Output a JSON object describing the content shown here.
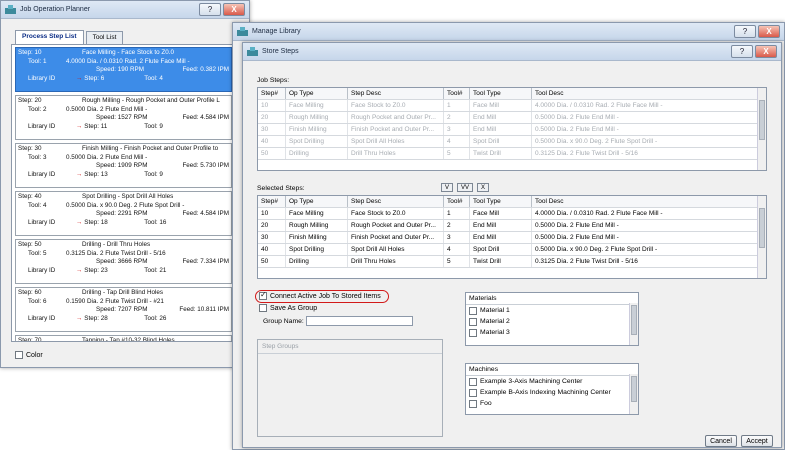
{
  "jop": {
    "title": "Job Operation Planner",
    "tabs": [
      "Process Step List",
      "Tool List"
    ],
    "steps": [
      {
        "step": "Step: 10",
        "title": "Face Milling - Face Stock to Z0.0",
        "tool": "Tool: 1",
        "desc": "4.0000 Dia. / 0.0310 Rad. 2 Flute Face Mill -",
        "speed": "Speed: 190 RPM",
        "feed": "Feed: 0.382 IPM",
        "lib": "Library ID",
        "lstep": "Step: 6",
        "ltool": "Tool: 4"
      },
      {
        "step": "Step: 20",
        "title": "Rough Milling - Rough Pocket and Outer Profile L",
        "tool": "Tool: 2",
        "desc": "0.5000 Dia. 2 Flute End Mill -",
        "speed": "Speed: 1527 RPM",
        "feed": "Feed: 4.584 IPM",
        "lib": "Library ID",
        "lstep": "Step: 11",
        "ltool": "Tool: 9"
      },
      {
        "step": "Step: 30",
        "title": "Finish Milling - Finish Pocket and Outer Profile to",
        "tool": "Tool: 3",
        "desc": "0.5000 Dia. 2 Flute End Mill -",
        "speed": "Speed: 1909 RPM",
        "feed": "Feed: 5.730 IPM",
        "lib": "Library ID",
        "lstep": "Step: 13",
        "ltool": "Tool: 9"
      },
      {
        "step": "Step: 40",
        "title": "Spot Drilling - Spot Drill All Holes",
        "tool": "Tool: 4",
        "desc": "0.5000 Dia. x 90.0 Deg. 2 Flute Spot Drill -",
        "speed": "Speed: 2291 RPM",
        "feed": "Feed: 4.584 IPM",
        "lib": "Library ID",
        "lstep": "Step: 18",
        "ltool": "Tool: 16"
      },
      {
        "step": "Step: 50",
        "title": "Drilling - Drill Thru Holes",
        "tool": "Tool: 5",
        "desc": "0.3125 Dia. 2 Flute Twist Drill - 5/16",
        "speed": "Speed: 3666 RPM",
        "feed": "Feed: 7.334 IPM",
        "lib": "Library ID",
        "lstep": "Step: 23",
        "ltool": "Tool: 21"
      },
      {
        "step": "Step: 60",
        "title": "Drilling - Tap Drill Blind Holes",
        "tool": "Tool: 6",
        "desc": "0.1590 Dia. 2 Flute Twist Drill - #21",
        "speed": "Speed: 7207 RPM",
        "feed": "Feed: 10.811 IPM",
        "lib": "Library ID",
        "lstep": "Step: 28",
        "ltool": "Tool: 26"
      }
    ],
    "last_step": {
      "step": "Step: 70",
      "title": "Tapping - Tap #10-32 Blind Holes"
    },
    "color_label": "Color"
  },
  "ml": {
    "title": "Manage Library"
  },
  "ss": {
    "title": "Store Steps",
    "job_steps_label": "Job Steps:",
    "selected_steps_label": "Selected Steps:",
    "headers": [
      "Step#",
      "Op Type",
      "Step Desc",
      "Tool#",
      "Tool Type",
      "Tool Desc"
    ],
    "rows": [
      [
        "10",
        "Face Milling",
        "Face Stock to Z0.0",
        "1",
        "Face Mill",
        "4.0000 Dia. / 0.0310 Rad. 2 Flute Face Mill -"
      ],
      [
        "20",
        "Rough Milling",
        "Rough Pocket and Outer Pr...",
        "2",
        "End Mill",
        "0.5000 Dia. 2 Flute End Mill -"
      ],
      [
        "30",
        "Finish Milling",
        "Finish Pocket and Outer Pr...",
        "3",
        "End Mill",
        "0.5000 Dia. 2 Flute End Mill -"
      ],
      [
        "40",
        "Spot Drilling",
        "Spot Drill All Holes",
        "4",
        "Spot Drill",
        "0.5000 Dia. x 90.0 Deg. 2 Flute Spot Drill -"
      ],
      [
        "50",
        "Drilling",
        "Drill Thru Holes",
        "5",
        "Twist Drill",
        "0.3125 Dia. 2 Flute Twist Drill - 5/16"
      ]
    ],
    "move_buttons": [
      "V",
      "VV",
      "X"
    ],
    "connect_label": "Connect Active Job To Stored Items",
    "save_group_label": "Save As Group",
    "group_name_label": "Group Name:",
    "step_groups_label": "Step Groups",
    "materials": {
      "header": "Materials",
      "items": [
        "Material 1",
        "Material 2",
        "Material 3"
      ]
    },
    "machines": {
      "header": "Machines",
      "items": [
        "Example 3-Axis Machining Center",
        "Example B-Axis Indexing Machining Center",
        "Foo"
      ]
    },
    "cancel": "Cancel",
    "accept": "Accept"
  },
  "title_buttons": {
    "help": "?",
    "close": "X"
  }
}
